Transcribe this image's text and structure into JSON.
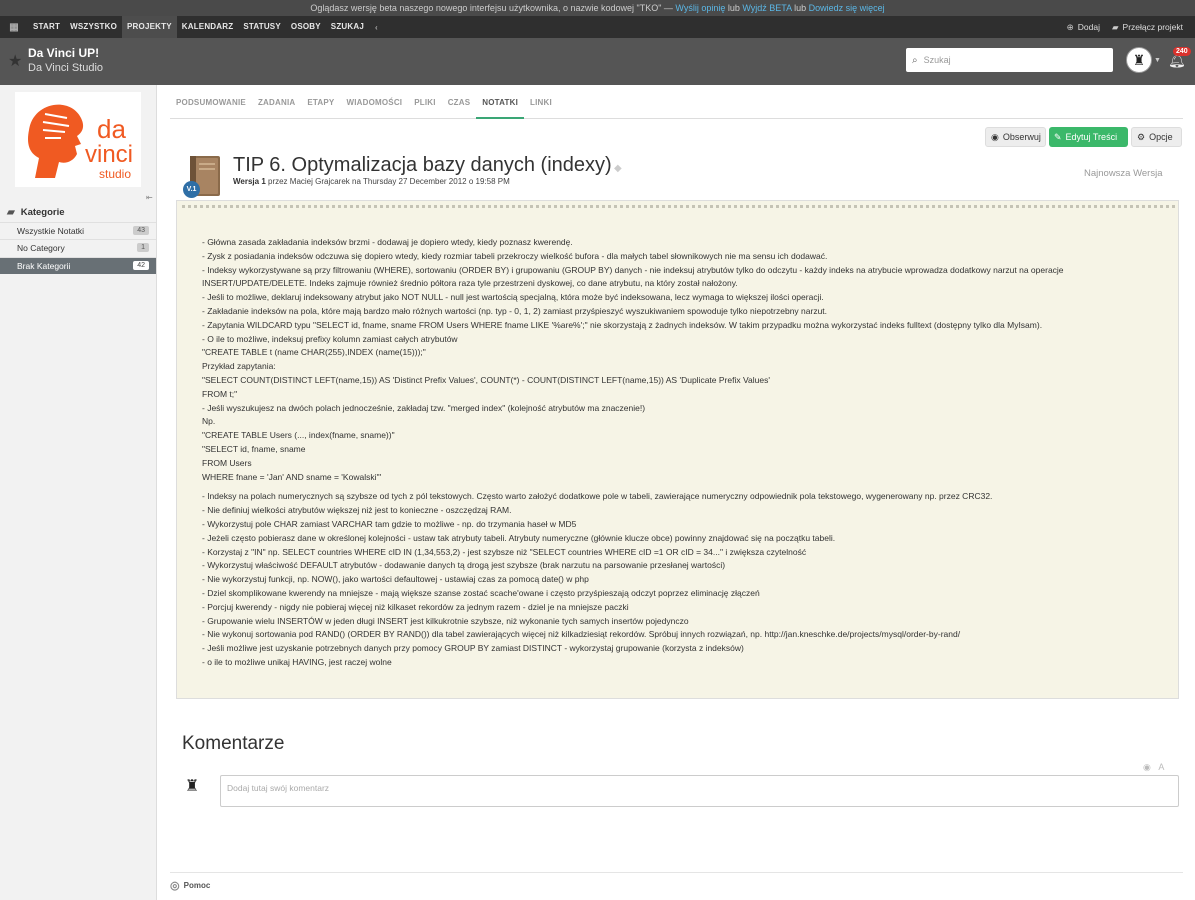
{
  "beta_bar": {
    "text": "Oglądasz wersję beta naszego nowego interfejsu użytkownika, o nazwie kodowej \"TKO\" — ",
    "link1": "Wyślij opinię",
    "sep1": " lub ",
    "link2": "Wyjdź BETA",
    "sep2": " lub ",
    "link3": "Dowiedz się więcej"
  },
  "topnav": {
    "items": [
      "START",
      "WSZYSTKO",
      "PROJEKTY",
      "KALENDARZ",
      "STATUSY",
      "OSOBY",
      "SZUKAJ"
    ],
    "active": "PROJEKTY",
    "add_label": "Dodaj",
    "switch_label": "Przełącz projekt"
  },
  "header": {
    "project_title": "Da Vinci UP!",
    "company": "Da Vinci Studio",
    "search_placeholder": "Szukaj",
    "notification_count": "240"
  },
  "sidebar": {
    "logo_text": [
      "da",
      "vinci",
      "studio"
    ],
    "category_heading": "Kategorie",
    "items": [
      {
        "label": "Wszystkie Notatki",
        "count": "43"
      },
      {
        "label": "No Category",
        "count": "1"
      },
      {
        "label": "Brak Kategorii",
        "count": "42"
      }
    ]
  },
  "tabs": [
    "PODSUMOWANIE",
    "ZADANIA",
    "ETAPY",
    "WIADOMOŚCI",
    "PLIKI",
    "CZAS",
    "NOTATKI",
    "LINKI"
  ],
  "active_tab": "NOTATKI",
  "actions": {
    "observe": "Obserwuj",
    "edit": "Edytuj Treści",
    "options": "Opcje"
  },
  "note": {
    "version_badge": "V.1",
    "title": "TIP 6. Optymalizacja bazy danych (indexy)",
    "version_label": "Wersja 1",
    "version_meta": " przez Maciej Grajcarek na Thursday 27 December 2012 o 19:58 PM",
    "latest_label": "Najnowsza Wersja",
    "lines_part1": [
      "- Główna zasada zakładania indeksów brzmi - dodawaj je dopiero wtedy, kiedy poznasz kwerendę.",
      "- Zysk z posiadania indeksów odczuwa się dopiero wtedy, kiedy rozmiar tabeli przekroczy wielkość bufora - dla małych tabel słownikowych nie ma sensu ich dodawać.",
      "- Indeksy wykorzystywane są przy filtrowaniu (WHERE), sortowaniu (ORDER BY) i grupowaniu (GROUP BY) danych - nie indeksuj atrybutów tylko do odczytu - każdy indeks na atrybucie wprowadza dodatkowy narzut na operacje",
      "INSERT/UPDATE/DELETE. Indeks zajmuje również średnio półtora raza tyle przestrzeni dyskowej, co dane atrybutu, na który został nałożony.",
      "- Jeśli to możliwe, deklaruj indeksowany atrybut jako NOT NULL - null jest wartością specjalną, która może być indeksowana, lecz wymaga to większej ilości operacji.",
      "- Zakładanie indeksów na pola, które mają bardzo mało różnych wartości (np. typ - 0, 1, 2) zamiast przyśpieszyć wyszukiwaniem spowoduje tylko niepotrzebny narzut.",
      "- Zapytania WILDCARD typu \"SELECT id, fname, sname FROM Users WHERE fname LIKE '%are%';\" nie skorzystają z żadnych indeksów. W takim przypadku można wykorzystać indeks fulltext (dostępny tylko dla MyIsam).",
      "- O ile to możliwe, indeksuj prefixy kolumn zamiast całych atrybutów",
      "\"CREATE TABLE t (name CHAR(255),INDEX (name(15)));\"",
      "Przykład zapytania:",
      "\"SELECT COUNT(DISTINCT LEFT(name,15)) AS 'Distinct Prefix Values', COUNT(*) - COUNT(DISTINCT LEFT(name,15)) AS 'Duplicate Prefix Values'",
      "FROM t;\"",
      "- Jeśli wyszukujesz na dwóch polach jednocześnie, zakładaj tzw. \"merged index\" (kolejność atrybutów ma znaczenie!)",
      "Np.",
      "\"CREATE TABLE Users (..., index(fname, sname))\"",
      "\"SELECT id, fname, sname",
      "FROM Users",
      "WHERE fnane = 'Jan' AND sname = 'Kowalski'\""
    ],
    "lines_part2": [
      "- Indeksy na polach numerycznych są szybsze od tych z pól tekstowych. Często warto założyć dodatkowe pole w tabeli, zawierające numeryczny odpowiednik pola tekstowego, wygenerowany np. przez CRC32.",
      "- Nie definiuj wielkości atrybutów większej niż jest to konieczne - oszczędzaj RAM.",
      "- Wykorzystuj pole CHAR zamiast VARCHAR tam gdzie to możliwe - np. do trzymania haseł w MD5",
      "- Jeżeli często pobierasz dane w określonej kolejności - ustaw tak atrybuty tabeli. Atrybuty numeryczne (głównie klucze obce) powinny znajdować się na początku tabeli.",
      "- Korzystaj z \"IN\" np. SELECT countries WHERE cID IN (1,34,553,2) - jest szybsze niż \"SELECT countries WHERE cID =1 OR cID = 34...\" i zwiększa czytelność",
      "- Wykorzystuj właściwość DEFAULT atrybutów - dodawanie danych tą drogą jest szybsze (brak narzutu na parsowanie przesłanej wartości)",
      "- Nie wykorzystuj funkcji, np. NOW(), jako wartości defaultowej - ustawiaj czas za pomocą date() w php",
      "- Dziel skomplikowane kwerendy na mniejsze - mają większe szanse zostać scache'owane i często przyśpieszają odczyt poprzez eliminację złączeń",
      "- Porcjuj kwerendy - nigdy nie pobieraj więcej niż kilkaset rekordów za jednym razem - dziel je na mniejsze paczki",
      "- Grupowanie wielu INSERTÓW w jeden długi INSERT jest kilkukrotnie szybsze, niż wykonanie tych samych insertów pojedynczo",
      "- Nie wykonuj sortowania pod RAND() (ORDER BY RAND()) dla tabel zawierających więcej niż kilkadziesiąt rekordów. Spróbuj innych rozwiązań, np. http://jan.kneschke.de/projects/mysql/order-by-rand/",
      "- Jeśli możliwe jest uzyskanie potrzebnych danych przy pomocy GROUP BY zamiast DISTINCT - wykorzystaj grupowanie (korzysta z indeksów)",
      "- o ile to możliwe unikaj HAVING, jest raczej wolne"
    ]
  },
  "comments": {
    "heading": "Komentarze",
    "placeholder": "Dodaj tutaj swój komentarz"
  },
  "footer": {
    "help": "Pomoc"
  },
  "colors": {
    "accent_green": "#3aa675",
    "brand_orange": "#f05a22",
    "badge_blue": "#2f6fa6",
    "notif_red": "#d9322d"
  }
}
